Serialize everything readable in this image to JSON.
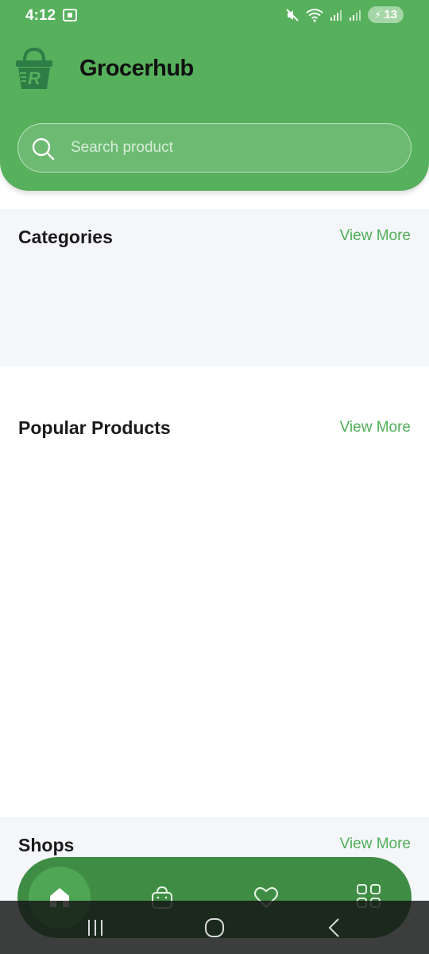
{
  "status_bar": {
    "time": "4:12",
    "battery": "13"
  },
  "header": {
    "app_title": "Grocerhub",
    "logo_icon": "shopping-basket-logo-icon",
    "search": {
      "placeholder": "Search product",
      "value": ""
    }
  },
  "sections": [
    {
      "title": "Categories",
      "action": "View More"
    },
    {
      "title": "Popular Products",
      "action": "View More"
    },
    {
      "title": "Shops",
      "action": "View More"
    }
  ],
  "bottom_nav": {
    "items": [
      {
        "icon": "home-icon",
        "active": true
      },
      {
        "icon": "shopping-bag-icon",
        "active": false
      },
      {
        "icon": "heart-icon",
        "active": false
      },
      {
        "icon": "grid-icon",
        "active": false
      }
    ]
  },
  "colors": {
    "primary": "#56b05c",
    "accent_text": "#4fae57",
    "section_bg": "#f4f6f9",
    "nav_bg": "#3f8d44"
  }
}
